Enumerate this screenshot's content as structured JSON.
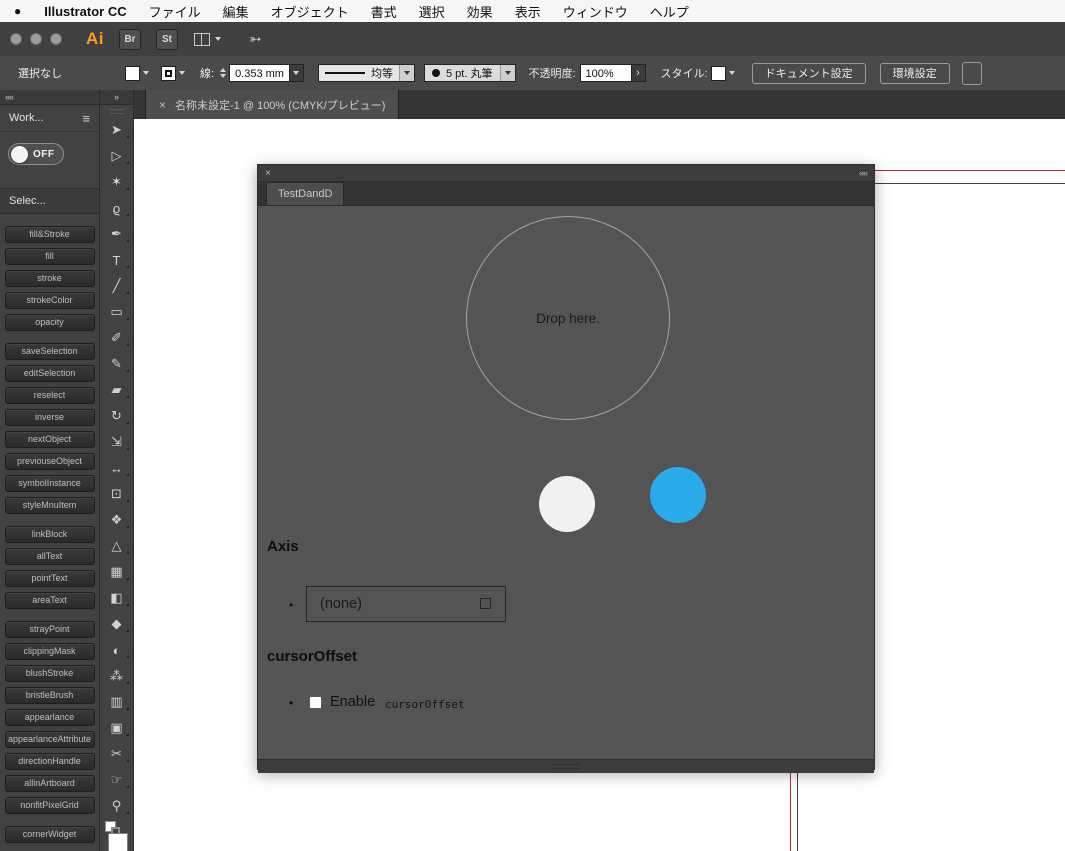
{
  "menu_bar": {
    "apple": "●",
    "app_name": "Illustrator CC",
    "items": [
      "ファイル",
      "編集",
      "オブジェクト",
      "書式",
      "選択",
      "効果",
      "表示",
      "ウィンドウ",
      "ヘルプ"
    ]
  },
  "title_bar": {
    "ai": "Ai",
    "br": "Br",
    "st": "St",
    "share": "➳"
  },
  "control_bar": {
    "selection": "選択なし",
    "stroke_label": "線:",
    "stroke_weight": "0.353 mm",
    "profile": "均等",
    "brush": "5 pt. 丸筆",
    "opacity_label": "不透明度:",
    "opacity_value": "100%",
    "opacity_more": "›",
    "style_label": "スタイル:",
    "doc_setup": "ドキュメント設定",
    "prefs": "環境設定"
  },
  "tab_bar": {
    "close": "×",
    "title": "名称未設定-1 @ 100% (CMYK/プレビュー)"
  },
  "dock": {
    "collapse": "««",
    "expand": "»",
    "workspace": "Work...",
    "menu_icon": "≡",
    "toggle": "OFF",
    "section": "Selec...",
    "groups": [
      [
        "fill&Stroke",
        "fill",
        "stroke",
        "strokeColor",
        "opacity"
      ],
      [
        "saveSelection",
        "editSelection",
        "reselect",
        "inverse",
        "nextObject",
        "previouseObject",
        "symbolInstance",
        "styleMnuItem"
      ],
      [
        "linkBlock",
        "allText",
        "pointText",
        "areaText"
      ],
      [
        "strayPoint",
        "clippingMask",
        "blushStroke",
        "bristleBrush",
        "appearlance",
        "appearlanceAttribute",
        "directionHandle",
        "allinArtboard",
        "nonfitPixelGrid"
      ],
      [
        "cornerWidget"
      ]
    ]
  },
  "tools": [
    {
      "name": "selection",
      "glyph": "➤"
    },
    {
      "name": "direct-selection",
      "glyph": "▷"
    },
    {
      "name": "magic-wand",
      "glyph": "✶"
    },
    {
      "name": "lasso",
      "glyph": "ϱ"
    },
    {
      "name": "pen",
      "glyph": "✒"
    },
    {
      "name": "type",
      "glyph": "T"
    },
    {
      "name": "line-segment",
      "glyph": "╱"
    },
    {
      "name": "rectangle",
      "glyph": "▭"
    },
    {
      "name": "paintbrush",
      "glyph": "✐"
    },
    {
      "name": "pencil",
      "glyph": "✎"
    },
    {
      "name": "eraser",
      "glyph": "▰"
    },
    {
      "name": "rotate",
      "glyph": "↻"
    },
    {
      "name": "scale",
      "glyph": "⇲"
    },
    {
      "name": "width",
      "glyph": "↔"
    },
    {
      "name": "free-transform",
      "glyph": "⊡"
    },
    {
      "name": "shape-builder",
      "glyph": "❖"
    },
    {
      "name": "perspective-grid",
      "glyph": "△"
    },
    {
      "name": "mesh",
      "glyph": "▦"
    },
    {
      "name": "gradient",
      "glyph": "◧"
    },
    {
      "name": "eyedropper",
      "glyph": "◆"
    },
    {
      "name": "blend",
      "glyph": "◐"
    },
    {
      "name": "symbol-sprayer",
      "glyph": "⁂"
    },
    {
      "name": "column-graph",
      "glyph": "▥"
    },
    {
      "name": "artboard",
      "glyph": "▣"
    },
    {
      "name": "slice",
      "glyph": "✂"
    },
    {
      "name": "hand",
      "glyph": "☞"
    },
    {
      "name": "zoom",
      "glyph": "⚲"
    }
  ],
  "panel": {
    "close": "×",
    "collapse": "««",
    "tab": "TestDandD",
    "drop": "Drop here.",
    "bullet": "•",
    "axis": {
      "heading": "Axis",
      "value": "(none)"
    },
    "cursor": {
      "heading": "cursorOffset",
      "enable": "Enable",
      "code": "cursorOffset"
    }
  },
  "colors": {
    "blue_circle": "#29ABE9",
    "white_circle": "#F1F1F1",
    "red_guide": "#C32430",
    "panel_body": "#545454",
    "accent_orange": "#FF9A1E"
  }
}
